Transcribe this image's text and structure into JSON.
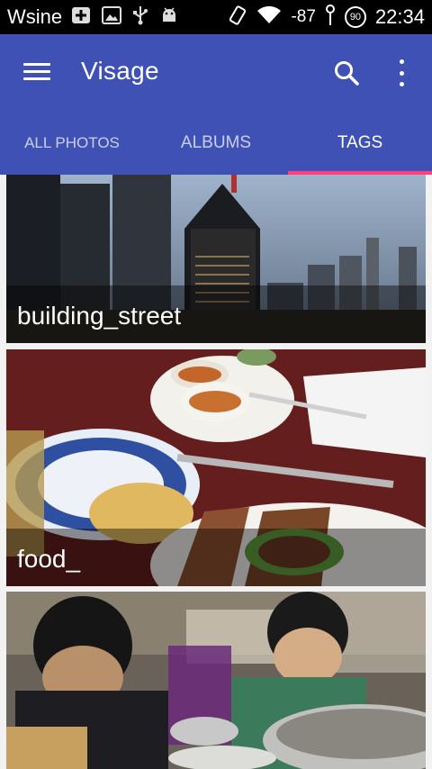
{
  "status_bar": {
    "carrier": "Wsine",
    "signal": "-87",
    "battery": "90",
    "time": "22:34"
  },
  "app_bar": {
    "title": "Visage",
    "color": "#3f51b5",
    "tabs": [
      {
        "label": "ALL PHOTOS",
        "active": false
      },
      {
        "label": "ALBUMS",
        "active": false
      },
      {
        "label": "TAGS",
        "active": true
      }
    ],
    "indicator_color": "#ff4081"
  },
  "cards": [
    {
      "caption": "building_street"
    },
    {
      "caption": "food_"
    },
    {
      "caption": ""
    }
  ]
}
